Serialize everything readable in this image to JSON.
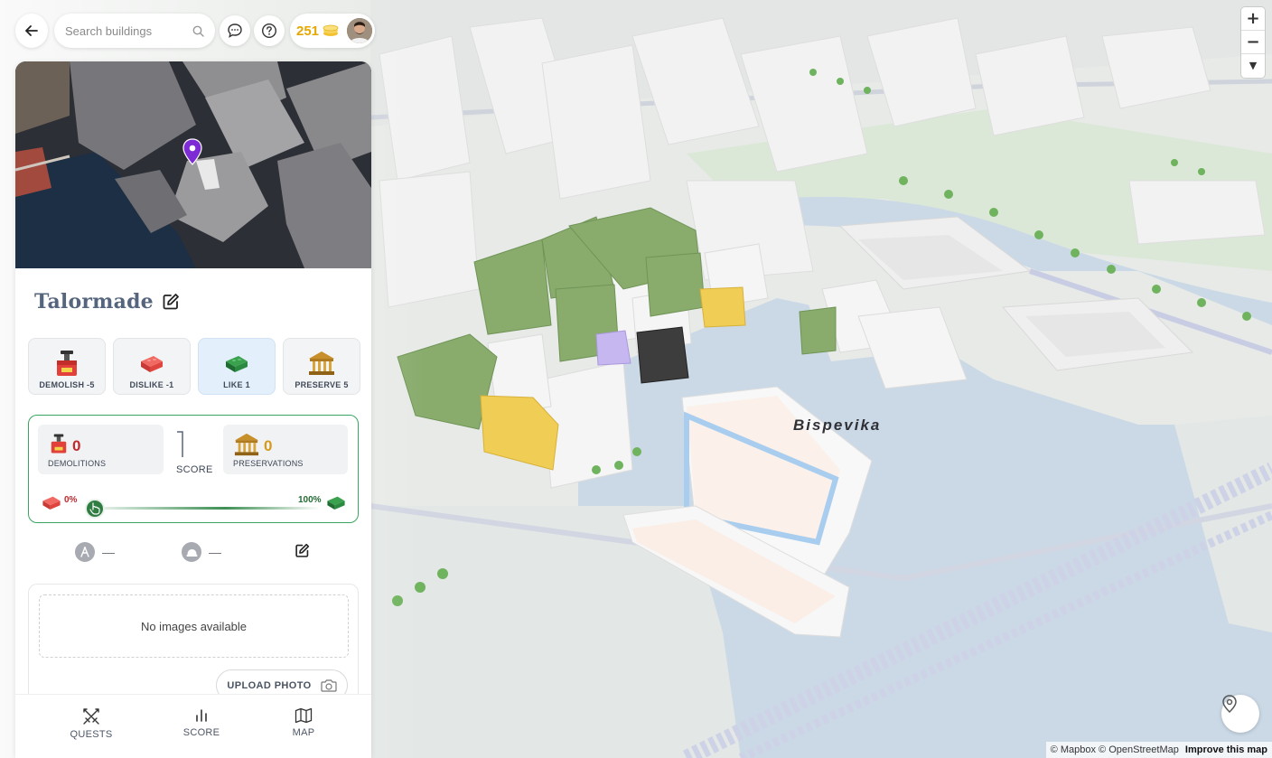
{
  "topbar": {
    "search_placeholder": "Search buildings",
    "coins": "251"
  },
  "building": {
    "title": "Talormade"
  },
  "actions": [
    {
      "label": "DEMOLISH -5"
    },
    {
      "label": "DISLIKE -1"
    },
    {
      "label": "LIKE 1",
      "active": true
    },
    {
      "label": "PRESERVE 5"
    }
  ],
  "score": {
    "demolitions_count": "0",
    "demolitions_label": "DEMOLITIONS",
    "score_label": "SCORE",
    "preservations_count": "0",
    "preservations_label": "PRESERVATIONS",
    "min_pct": "0%",
    "max_pct": "100%"
  },
  "meta": {
    "architect": "—",
    "builder": "—"
  },
  "gallery": {
    "empty_text": "No images available",
    "upload_label": "UPLOAD PHOTO"
  },
  "nav": {
    "quests": "QUESTS",
    "score": "SCORE",
    "map": "MAP"
  },
  "map": {
    "district_label": "Bispevika",
    "attribution_mapbox": "© Mapbox",
    "attribution_osm": "© OpenStreetMap",
    "improve_link": "Improve this map"
  },
  "colors": {
    "accent_green": "#3aa560",
    "demolish_red": "#c0292f",
    "preserve_gold": "#d49a1c",
    "title_slate": "#56657e",
    "water": "#cbd9e6"
  }
}
